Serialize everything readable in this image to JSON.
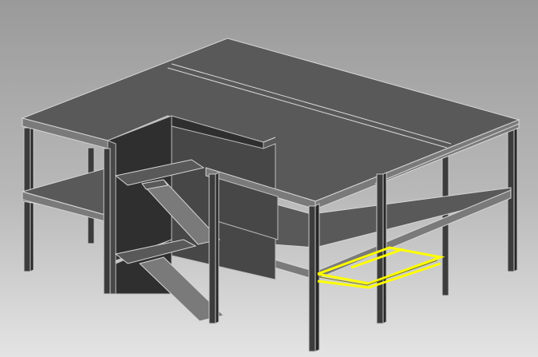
{
  "colors": {
    "background_top": "#9a9a9a",
    "background_bottom": "#e4e4e4",
    "slab_top": "#595959",
    "slab_edge": "#d6d6d6",
    "column": "#3c3c3c",
    "selection": "#ffff00"
  }
}
